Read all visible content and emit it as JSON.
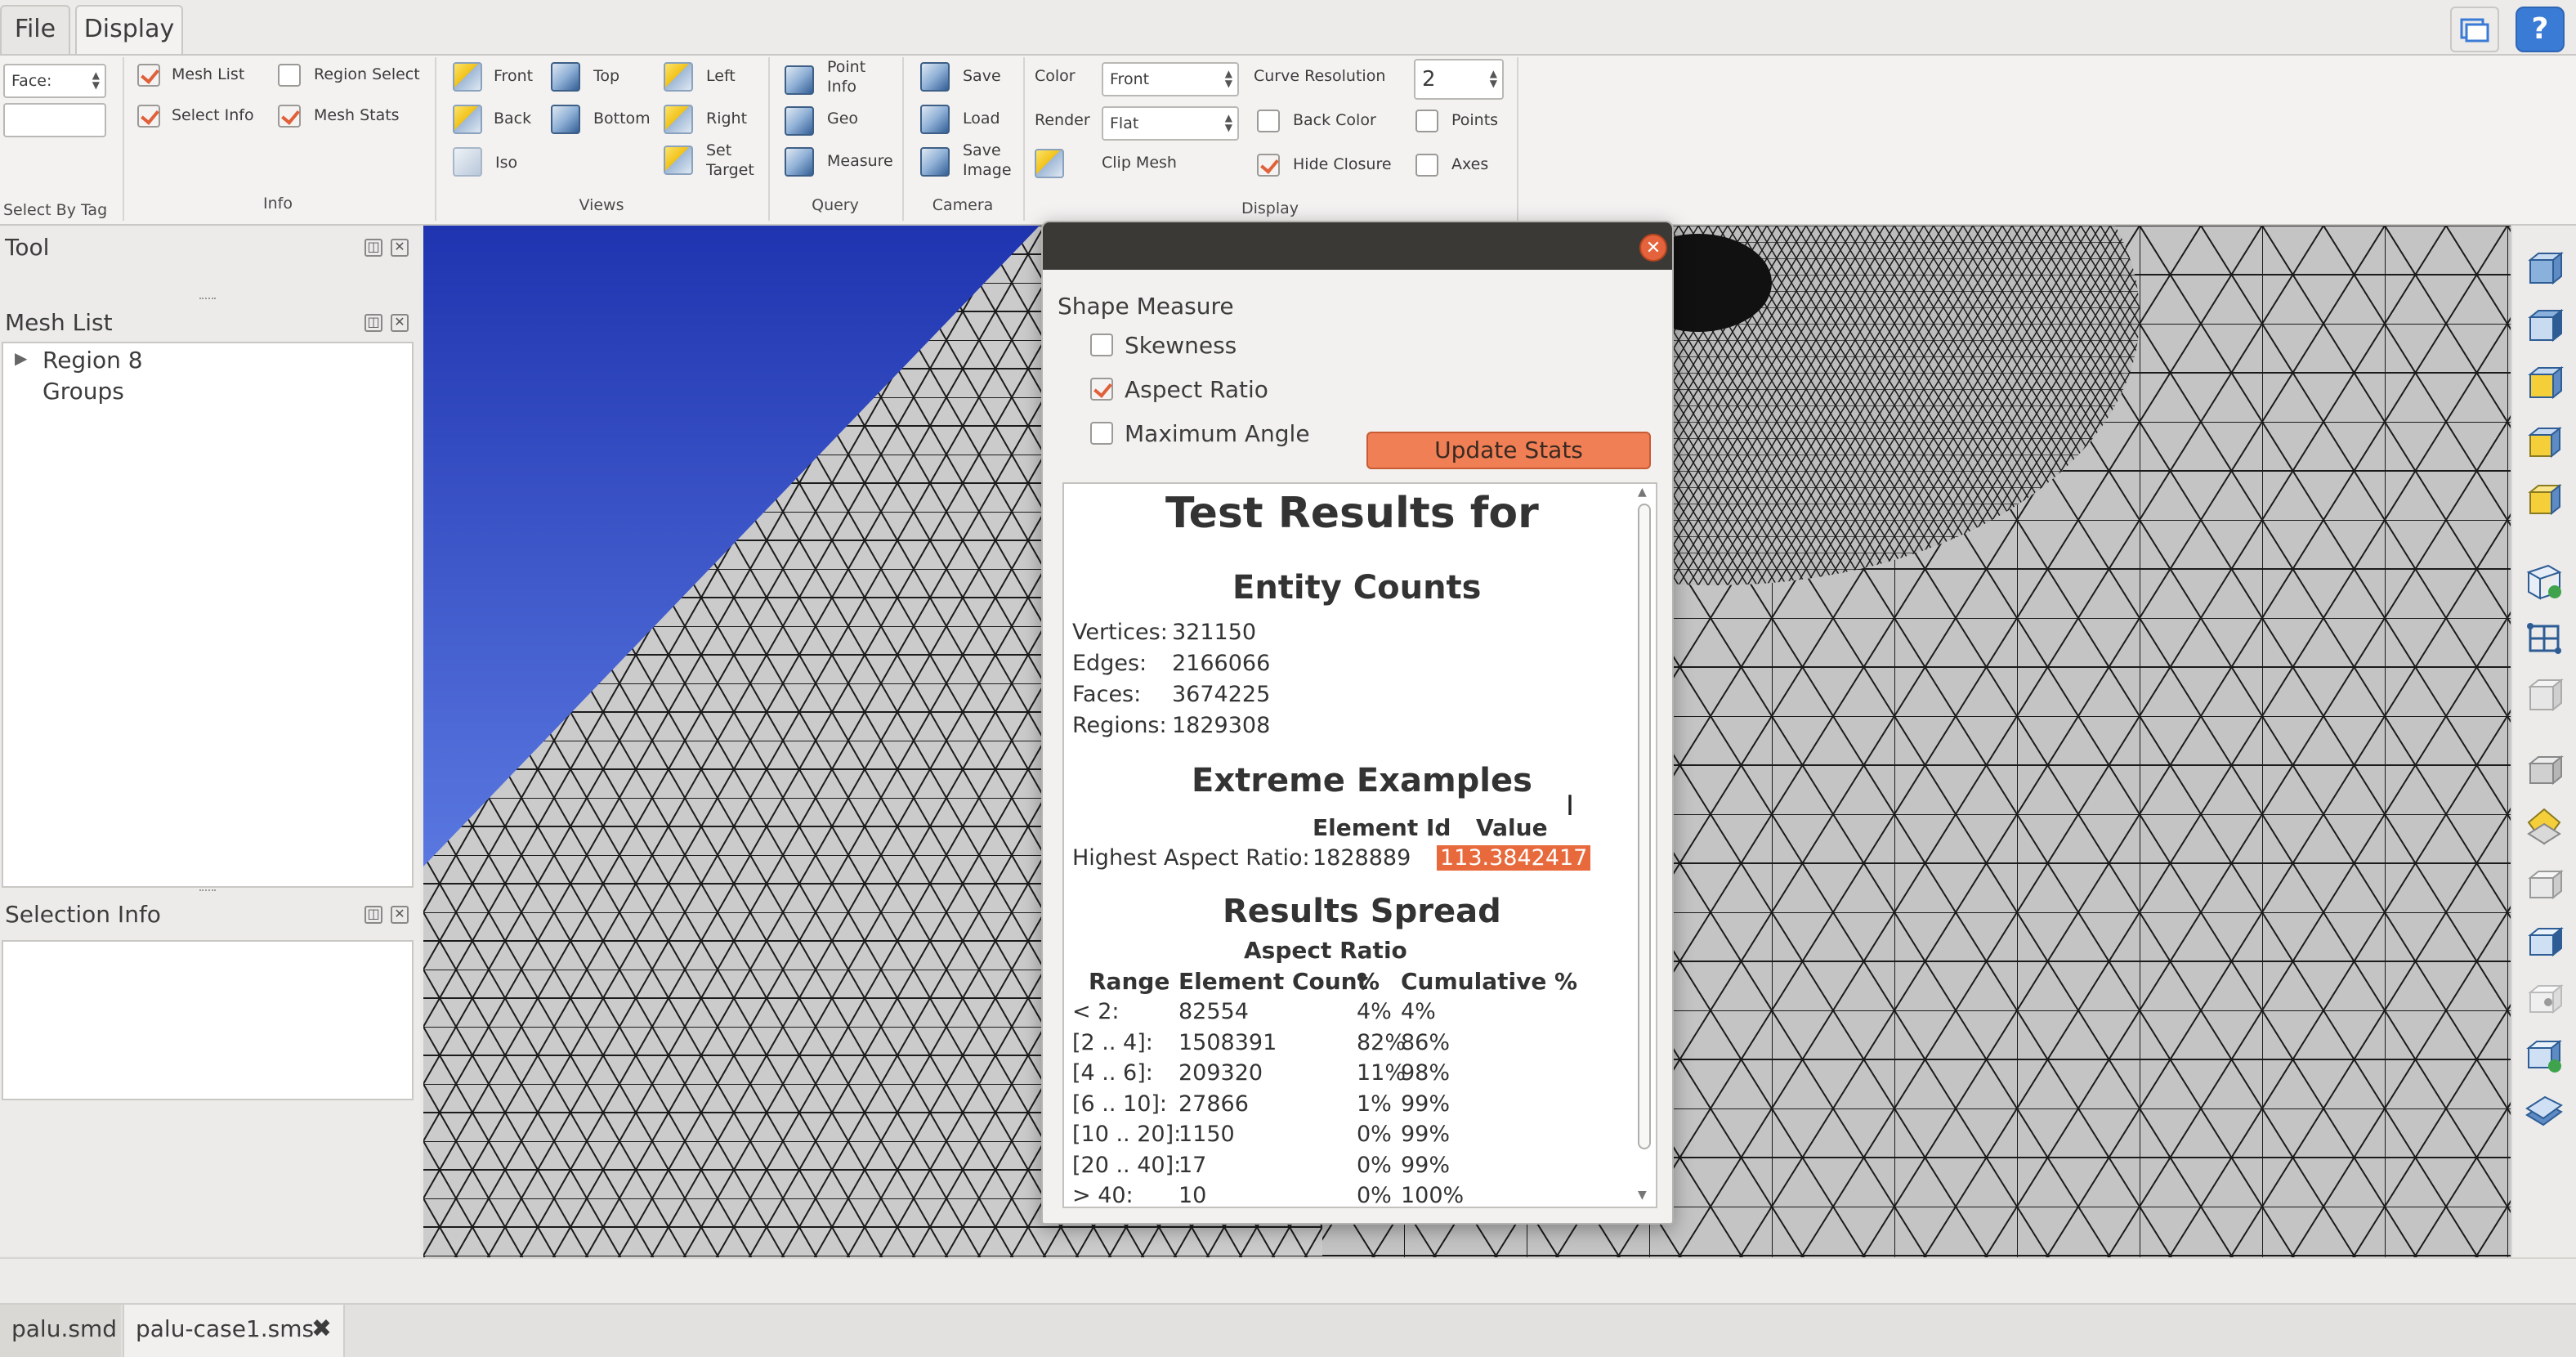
{
  "menu": {
    "file": "File",
    "display": "Display"
  },
  "ribbon": {
    "select_by_tag": {
      "face_label": "Face:",
      "tag_value": "",
      "group": "Select By Tag"
    },
    "info": {
      "mesh_list": "Mesh List",
      "region_select": "Region Select",
      "select_info": "Select Info",
      "mesh_stats": "Mesh Stats",
      "group": "Info"
    },
    "views": {
      "front": "Front",
      "top": "Top",
      "left": "Left",
      "back": "Back",
      "bottom": "Bottom",
      "right": "Right",
      "iso": "Iso",
      "set_target": "Set Target",
      "group": "Views"
    },
    "query": {
      "point_info": "Point Info",
      "geo": "Geo",
      "measure": "Measure",
      "group": "Query"
    },
    "camera": {
      "save": "Save",
      "load": "Load",
      "save_image": "Save Image",
      "group": "Camera"
    },
    "display": {
      "color_label": "Color",
      "color_value": "Front",
      "render_label": "Render",
      "render_value": "Flat",
      "clip_mesh": "Clip Mesh",
      "curve_resolution_label": "Curve Resolution",
      "curve_resolution_value": "2",
      "back_color": "Back Color",
      "points": "Points",
      "hide_closure": "Hide Closure",
      "axes": "Axes",
      "group": "Display"
    }
  },
  "left_dock": {
    "tool_title": "Tool",
    "mesh_list_title": "Mesh List",
    "tree": [
      "Region 8",
      "Groups"
    ],
    "selection_info_title": "Selection Info"
  },
  "dialog": {
    "shape_measure": "Shape Measure",
    "skewness": "Skewness",
    "aspect_ratio": "Aspect Ratio",
    "maximum_angle": "Maximum Angle",
    "update_stats": "Update Stats",
    "results": {
      "title": "Test Results for",
      "entity_counts_title": "Entity Counts",
      "entity_counts": [
        {
          "label": "Vertices:",
          "value": "321150"
        },
        {
          "label": "Edges:",
          "value": "2166066"
        },
        {
          "label": "Faces:",
          "value": "3674225"
        },
        {
          "label": "Regions:",
          "value": "1829308"
        }
      ],
      "extreme_title": "Extreme Examples",
      "extreme_headers": [
        "Element Id",
        "Value"
      ],
      "extreme_row": {
        "label": "Highest Aspect Ratio:",
        "element_id": "1828889",
        "value": "113.3842417"
      },
      "spread_title": "Results Spread",
      "spread_subtitle": "Aspect Ratio",
      "spread_headers": [
        "Range",
        "Element Count",
        "%",
        "Cumulative %"
      ],
      "spread_rows": [
        [
          "< 2:",
          "82554",
          "4%",
          "4%"
        ],
        [
          "[2 .. 4]:",
          "1508391",
          "82%",
          "86%"
        ],
        [
          "[4 .. 6]:",
          "209320",
          "11%",
          "98%"
        ],
        [
          "[6 .. 10]:",
          "27866",
          "1%",
          "99%"
        ],
        [
          "[10 .. 20]:",
          "1150",
          "0%",
          "99%"
        ],
        [
          "[20 .. 40]:",
          "17",
          "0%",
          "99%"
        ],
        [
          "> 40:",
          "10",
          "0%",
          "100%"
        ]
      ]
    }
  },
  "tabs": {
    "doc1": "palu.smd",
    "doc2": "palu-case1.sms"
  },
  "colors": {
    "accent": "#e86a3c",
    "button": "#f07f55",
    "viewport_blue": "#2a3fb8",
    "mesh_gray": "#c8c8c8"
  }
}
